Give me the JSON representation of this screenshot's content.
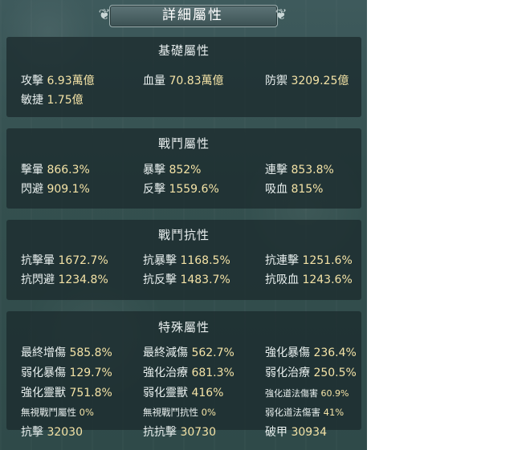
{
  "header": {
    "title": "詳細屬性"
  },
  "sections": [
    {
      "title": "基礎屬性",
      "stats": [
        {
          "label": "攻擊",
          "value": "6.93萬億"
        },
        {
          "label": "血量",
          "value": "70.83萬億"
        },
        {
          "label": "防禦",
          "value": "3209.25億"
        },
        {
          "label": "敏捷",
          "value": "1.75億"
        }
      ]
    },
    {
      "title": "戰鬥屬性",
      "stats": [
        {
          "label": "擊暈",
          "value": "866.3%"
        },
        {
          "label": "暴擊",
          "value": "852%"
        },
        {
          "label": "連擊",
          "value": "853.8%"
        },
        {
          "label": "閃避",
          "value": "909.1%"
        },
        {
          "label": "反擊",
          "value": "1559.6%"
        },
        {
          "label": "吸血",
          "value": "815%"
        }
      ]
    },
    {
      "title": "戰鬥抗性",
      "stats": [
        {
          "label": "抗擊暈",
          "value": "1672.7%"
        },
        {
          "label": "抗暴擊",
          "value": "1168.5%"
        },
        {
          "label": "抗連擊",
          "value": "1251.6%"
        },
        {
          "label": "抗閃避",
          "value": "1234.8%"
        },
        {
          "label": "抗反擊",
          "value": "1483.7%"
        },
        {
          "label": "抗吸血",
          "value": "1243.6%"
        }
      ]
    },
    {
      "title": "特殊屬性",
      "stats": [
        {
          "label": "最終增傷",
          "value": "585.8%"
        },
        {
          "label": "最終減傷",
          "value": "562.7%"
        },
        {
          "label": "強化暴傷",
          "value": "236.4%"
        },
        {
          "label": "弱化暴傷",
          "value": "129.7%"
        },
        {
          "label": "強化治療",
          "value": "681.3%"
        },
        {
          "label": "弱化治療",
          "value": "250.5%"
        },
        {
          "label": "強化靈獸",
          "value": "751.8%"
        },
        {
          "label": "弱化靈獸",
          "value": "416%"
        },
        {
          "label": "強化道法傷害",
          "value": "60.9%"
        },
        {
          "label": "無視戰鬥屬性",
          "value": "0%"
        },
        {
          "label": "無視戰鬥抗性",
          "value": "0%"
        },
        {
          "label": "弱化道法傷害",
          "value": "41%"
        },
        {
          "label": "抗擊",
          "value": "32030"
        },
        {
          "label": "抗抗擊",
          "value": "30730"
        },
        {
          "label": "破甲",
          "value": "30934"
        }
      ]
    }
  ]
}
